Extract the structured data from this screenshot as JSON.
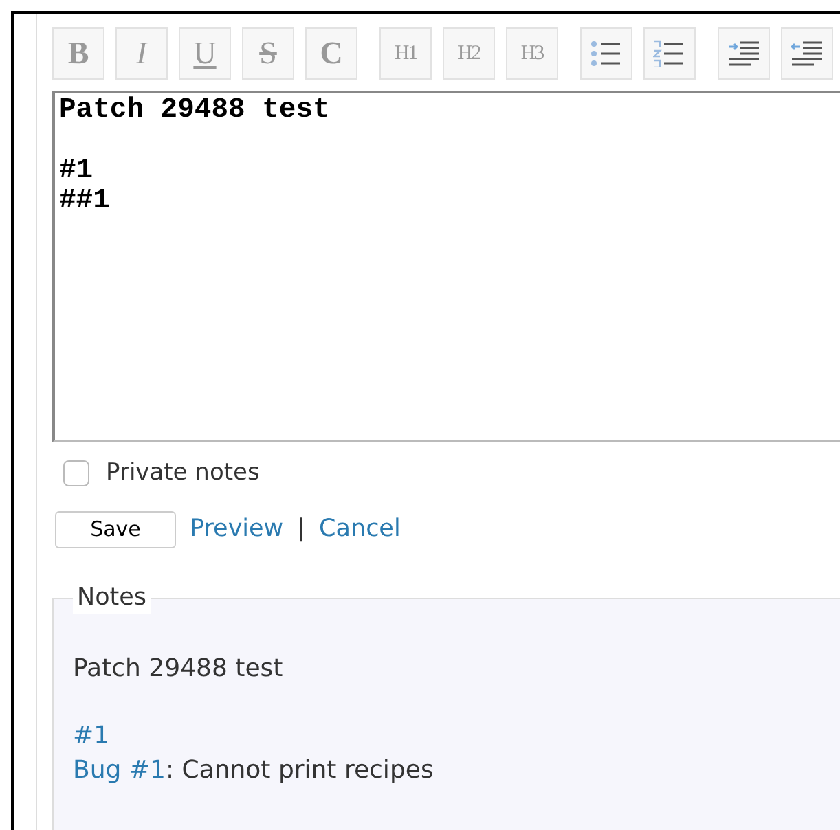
{
  "toolbar": [
    {
      "kind": "bold",
      "label": "B"
    },
    {
      "kind": "italic",
      "label": "I"
    },
    {
      "kind": "underline",
      "label": "U"
    },
    {
      "kind": "strike",
      "label": "S"
    },
    {
      "kind": "code",
      "label": "C"
    },
    {
      "kind": "heading",
      "label": "H1"
    },
    {
      "kind": "heading",
      "label": "H2"
    },
    {
      "kind": "heading",
      "label": "H3"
    },
    {
      "kind": "bullet-list"
    },
    {
      "kind": "numbered-list"
    },
    {
      "kind": "indent-right"
    },
    {
      "kind": "indent-left"
    }
  ],
  "editor": {
    "value": "Patch 29488 test\n\n#1\n##1"
  },
  "private_notes": {
    "label": "Private notes",
    "checked": false
  },
  "actions": {
    "save": "Save",
    "preview": "Preview",
    "separator": "|",
    "cancel": "Cancel"
  },
  "notes": {
    "legend": "Notes",
    "paragraphs": [
      [
        [
          {
            "kind": "text",
            "text": "Patch 29488 test"
          }
        ]
      ],
      [
        [
          {
            "kind": "link",
            "text": "#1"
          }
        ],
        [
          {
            "kind": "link",
            "text": "Bug #1"
          },
          {
            "kind": "text",
            "text": ": Cannot print recipes"
          }
        ]
      ]
    ]
  }
}
